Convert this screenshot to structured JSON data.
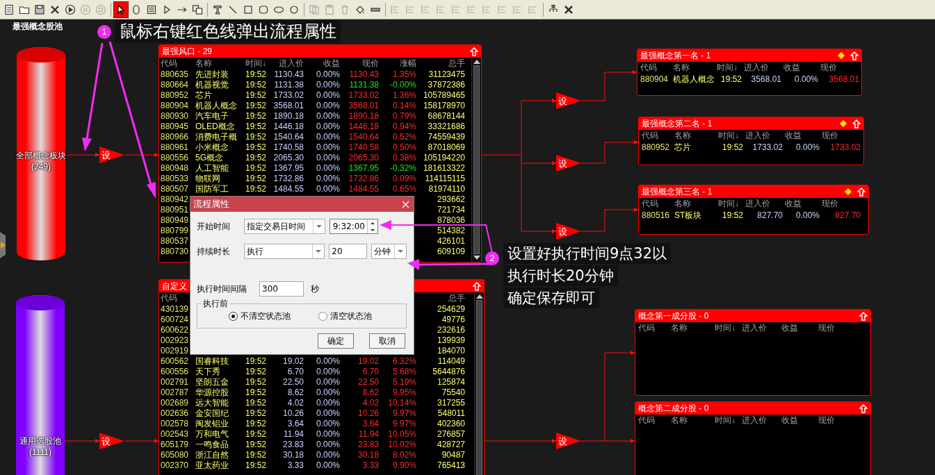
{
  "toolbar": {
    "tools": [
      {
        "selected": false,
        "disabled": false
      },
      {
        "selected": false,
        "disabled": false
      },
      {
        "selected": false,
        "disabled": false
      },
      {
        "selected": false,
        "disabled": false
      },
      {
        "selected": false,
        "disabled": false
      },
      {
        "selected": false,
        "disabled": true
      },
      {
        "selected": false,
        "disabled": true
      },
      {
        "selected": true,
        "disabled": false
      },
      {
        "selected": false,
        "disabled": false
      },
      {
        "selected": false,
        "disabled": false
      },
      {
        "selected": false,
        "disabled": false
      },
      {
        "selected": false,
        "disabled": false
      },
      {
        "selected": false,
        "disabled": false
      },
      {
        "selected": false,
        "disabled": false
      },
      {
        "selected": false,
        "disabled": false
      },
      {
        "selected": false,
        "disabled": false
      },
      {
        "selected": false,
        "disabled": false
      },
      {
        "selected": false,
        "disabled": false
      },
      {
        "selected": false,
        "disabled": false
      },
      {
        "selected": false,
        "disabled": true
      },
      {
        "selected": false,
        "disabled": true
      },
      {
        "selected": false,
        "disabled": true
      },
      {
        "selected": false,
        "disabled": false
      },
      {
        "selected": false,
        "disabled": false
      },
      {
        "selected": false,
        "disabled": true
      },
      {
        "selected": false,
        "disabled": true
      },
      {
        "selected": false,
        "disabled": true
      },
      {
        "selected": false,
        "disabled": true
      },
      {
        "selected": false,
        "disabled": true
      },
      {
        "selected": false,
        "disabled": true
      },
      {
        "selected": false,
        "disabled": true
      },
      {
        "selected": false,
        "disabled": true
      },
      {
        "selected": false,
        "disabled": true
      },
      {
        "selected": false,
        "disabled": true
      },
      {
        "selected": false,
        "disabled": false
      },
      {
        "selected": false,
        "disabled": false
      }
    ]
  },
  "canvas_title": "最强概念股池",
  "pools": [
    {
      "name": "全部概念板块",
      "count": "(249)",
      "color": "#ff0000"
    },
    {
      "name": "通用选股池",
      "count": "(1111)",
      "color": "#8000ff"
    }
  ],
  "set_nodes": [
    {
      "label": "设"
    },
    {
      "label": "设"
    },
    {
      "label": "设"
    },
    {
      "label": "设"
    },
    {
      "label": "设"
    },
    {
      "label": "设"
    }
  ],
  "tables": [
    {
      "title": "最强风口 - 29",
      "header": {
        "code": "代码",
        "name": "名称",
        "time": "时间↓",
        "entry": "进入价",
        "profit": "收益",
        "price": "现价",
        "change": "涨幅",
        "total": "总手"
      },
      "rows": [
        {
          "code": "880635",
          "name": "先进封装",
          "time": "19:52",
          "entry": "1130.43",
          "profit": "0.00%",
          "price": "1130.43",
          "change": "1.35%",
          "total": "31123475",
          "color": "#ff2a2a"
        },
        {
          "code": "880664",
          "name": "机器视觉",
          "time": "19:52",
          "entry": "1131.38",
          "profit": "0.00%",
          "price": "1131.38",
          "change": "-0.00%",
          "total": "37872386",
          "color": "#20e020"
        },
        {
          "code": "880952",
          "name": "芯片",
          "time": "19:52",
          "entry": "1733.02",
          "profit": "0.00%",
          "price": "1733.02",
          "change": "1.36%",
          "total": "105789465",
          "color": "#ff2a2a"
        },
        {
          "code": "880904",
          "name": "机器人概念",
          "time": "19:52",
          "entry": "3568.01",
          "profit": "0.00%",
          "price": "3568.01",
          "change": "0.14%",
          "total": "158178970",
          "color": "#ff2a2a"
        },
        {
          "code": "880930",
          "name": "汽车电子",
          "time": "19:52",
          "entry": "1890.18",
          "profit": "0.00%",
          "price": "1890.18",
          "change": "0.79%",
          "total": "68678144",
          "color": "#ff2a2a"
        },
        {
          "code": "880945",
          "name": "OLED概念",
          "time": "19:52",
          "entry": "1446.18",
          "profit": "0.00%",
          "price": "1446.18",
          "change": "0.94%",
          "total": "33321686",
          "color": "#ff2a2a"
        },
        {
          "code": "880966",
          "name": "消费电子概",
          "time": "19:52",
          "entry": "1540.64",
          "profit": "0.00%",
          "price": "1540.64",
          "change": "0.52%",
          "total": "74559439",
          "color": "#ff2a2a"
        },
        {
          "code": "880961",
          "name": "小米概念",
          "time": "19:52",
          "entry": "1740.58",
          "profit": "0.00%",
          "price": "1740.58",
          "change": "0.50%",
          "total": "87018069",
          "color": "#ff2a2a"
        },
        {
          "code": "880556",
          "name": "5G概念",
          "time": "19:52",
          "entry": "2065.30",
          "profit": "0.00%",
          "price": "2065.30",
          "change": "0.38%",
          "total": "105194220",
          "color": "#ff2a2a"
        },
        {
          "code": "880948",
          "name": "人工智能",
          "time": "19:52",
          "entry": "1367.95",
          "profit": "0.00%",
          "price": "1367.95",
          "change": "-0.32%",
          "total": "181613322",
          "color": "#20e020"
        },
        {
          "code": "880533",
          "name": "物联网",
          "time": "19:52",
          "entry": "1732.86",
          "profit": "0.00%",
          "price": "1732.86",
          "change": "0.09%",
          "total": "114115115",
          "color": "#ff2a2a"
        },
        {
          "code": "880507",
          "name": "国防军工",
          "time": "19:52",
          "entry": "1484.55",
          "profit": "0.00%",
          "price": "1484.55",
          "change": "0.65%",
          "total": "81974110",
          "color": "#ff2a2a"
        },
        {
          "code": "880942",
          "total": "293662"
        },
        {
          "code": "880951",
          "total": "721734"
        },
        {
          "code": "880949",
          "total": "878036"
        },
        {
          "code": "880799",
          "total": "514382"
        },
        {
          "code": "880537",
          "total": "426101"
        },
        {
          "code": "880730",
          "total": "609109"
        }
      ]
    },
    {
      "title": "自定义",
      "header": {
        "code": "代码",
        "total": "总手"
      },
      "rows": [
        {
          "code": "430139",
          "total": "254629"
        },
        {
          "code": "600724",
          "total": "49776"
        },
        {
          "code": "600622",
          "total": "232616"
        },
        {
          "code": "002923",
          "total": "139939"
        },
        {
          "code": "002919",
          "total": "184070"
        },
        {
          "code": "600562",
          "name": "国睿科技",
          "time": "19:52",
          "entry": "19.02",
          "profit": "0.00%",
          "price": "19.02",
          "change": "6.32%",
          "total": "114049",
          "color": "#ff2a2a"
        },
        {
          "code": "600556",
          "name": "天下秀",
          "time": "19:52",
          "entry": "6.70",
          "profit": "0.00%",
          "price": "6.70",
          "change": "5.68%",
          "total": "5644876",
          "color": "#ff2a2a"
        },
        {
          "code": "002791",
          "name": "坚朗五金",
          "time": "19:52",
          "entry": "22.50",
          "profit": "0.00%",
          "price": "22.50",
          "change": "5.19%",
          "total": "125874",
          "color": "#ff2a2a"
        },
        {
          "code": "002787",
          "name": "华源控股",
          "time": "19:52",
          "entry": "8.62",
          "profit": "0.00%",
          "price": "8.62",
          "change": "9.95%",
          "total": "75540",
          "color": "#ff2a2a"
        },
        {
          "code": "002689",
          "name": "远大智能",
          "time": "19:52",
          "entry": "4.02",
          "profit": "0.00%",
          "price": "4.02",
          "change": "10.14%",
          "total": "317255",
          "color": "#ff2a2a"
        },
        {
          "code": "002636",
          "name": "金安国纪",
          "time": "19:52",
          "entry": "10.26",
          "profit": "0.00%",
          "price": "10.26",
          "change": "9.97%",
          "total": "548011",
          "color": "#ff2a2a"
        },
        {
          "code": "002578",
          "name": "闽发铝业",
          "time": "19:52",
          "entry": "3.64",
          "profit": "0.00%",
          "price": "3.64",
          "change": "9.97%",
          "total": "402360",
          "color": "#ff2a2a"
        },
        {
          "code": "002543",
          "name": "万和电气",
          "time": "19:52",
          "entry": "11.94",
          "profit": "0.00%",
          "price": "11.94",
          "change": "10.05%",
          "total": "276857",
          "color": "#ff2a2a"
        },
        {
          "code": "605179",
          "name": "一鸣食品",
          "time": "19:52",
          "entry": "23.83",
          "profit": "0.00%",
          "price": "23.83",
          "change": "10.02%",
          "total": "428727",
          "color": "#ff2a2a"
        },
        {
          "code": "605080",
          "name": "浙江自然",
          "time": "19:52",
          "entry": "30.18",
          "profit": "0.00%",
          "price": "30.18",
          "change": "8.02%",
          "total": "90487",
          "color": "#ff2a2a"
        },
        {
          "code": "002370",
          "name": "亚太药业",
          "time": "19:52",
          "entry": "3.33",
          "profit": "0.00%",
          "price": "3.33",
          "change": "9.90%",
          "total": "765413",
          "color": "#ff2a2a"
        }
      ]
    }
  ],
  "result_panels": [
    {
      "title": "最强概念第一名 - 1",
      "flagged": true,
      "columns": [
        "代码",
        "名称",
        "时间↓",
        "进入价",
        "收益",
        "现价"
      ],
      "rows": [
        {
          "code": "880904",
          "name": "机器人概念",
          "time": "19:52",
          "entry": "3568.01",
          "profit": "0.00%",
          "price": "3568.01"
        }
      ]
    },
    {
      "title": "最强概念第二名 - 1",
      "flagged": true,
      "columns": [
        "代码",
        "名称",
        "时间↓",
        "进入价",
        "收益",
        "现价"
      ],
      "rows": [
        {
          "code": "880952",
          "name": "芯片",
          "time": "19:52",
          "entry": "1733.02",
          "profit": "0.00%",
          "price": "1733.02"
        }
      ]
    },
    {
      "title": "最强概念第三名 - 1",
      "flagged": true,
      "columns": [
        "代码",
        "名称",
        "时间↓",
        "进入价",
        "收益",
        "现价"
      ],
      "rows": [
        {
          "code": "880516",
          "name": "ST板块",
          "time": "19:52",
          "entry": "827.70",
          "profit": "0.00%",
          "price": "827.70"
        }
      ]
    },
    {
      "title": "概念第一成分股 - 0",
      "flagged": false,
      "columns": [
        "代码",
        "名称",
        "时间↓",
        "进入价",
        "收益",
        "现价"
      ]
    },
    {
      "title": "概念第二成分股 - 0",
      "flagged": false,
      "columns": [
        "代码",
        "名称",
        "时间↓",
        "进入价",
        "收益",
        "现价"
      ]
    }
  ],
  "dialog": {
    "title": "流程属性",
    "start": {
      "label": "开始时间",
      "mode": "指定交易日时间",
      "time": "9:32:00"
    },
    "duration": {
      "label": "持续时长",
      "mode": "执行",
      "value": "20",
      "unit": "分钟"
    },
    "interval": {
      "label": "执行时间间隔",
      "value": "300",
      "unit": "秒"
    },
    "before_run": {
      "legend": "执行前",
      "options": [
        {
          "label": "不清空状态池",
          "selected": true
        },
        {
          "label": "清空状态池",
          "selected": false
        }
      ]
    },
    "buttons": [
      "确定",
      "取消"
    ]
  },
  "annotations": [
    {
      "number": "1",
      "lines": [
        "鼠标右键红色线弹出流程属性"
      ]
    },
    {
      "number": "2",
      "lines": [
        "设置好执行时间9点32以",
        "执行时长20分钟",
        "确定保存即可"
      ]
    }
  ]
}
